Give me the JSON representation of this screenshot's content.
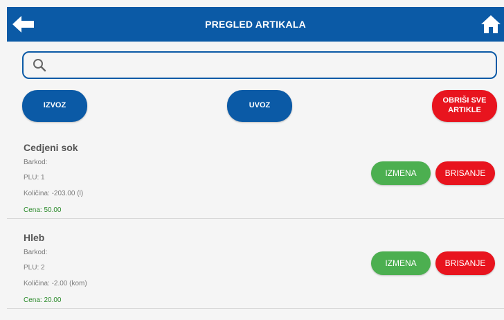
{
  "header": {
    "title": "PREGLED ARTIKALA"
  },
  "search": {
    "placeholder": "",
    "value": ""
  },
  "toolbar": {
    "export_label": "IZVOZ",
    "import_label": "UVOZ",
    "delete_all_line1": "OBRIŠI SVE",
    "delete_all_line2": "ARTIKLE"
  },
  "items": [
    {
      "name": "Cedjeni sok",
      "barcode": "Barkod:",
      "plu": "PLU: 1",
      "quantity": "Količina: -203.00 (l)",
      "price": "Cena: 50.00",
      "edit_label": "IZMENA",
      "delete_label": "BRISANJE"
    },
    {
      "name": "Hleb",
      "barcode": "Barkod:",
      "plu": "PLU: 2",
      "quantity": "Količina: -2.00 (kom)",
      "price": "Cena: 20.00",
      "edit_label": "IZMENA",
      "delete_label": "BRISANJE"
    }
  ],
  "colors": {
    "primary": "#0b5aa6",
    "danger": "#e8141e",
    "success": "#4caf50",
    "price": "#2a8a2a"
  },
  "icons": {
    "back": "back-arrow-icon",
    "home": "home-icon",
    "search": "search-icon"
  }
}
